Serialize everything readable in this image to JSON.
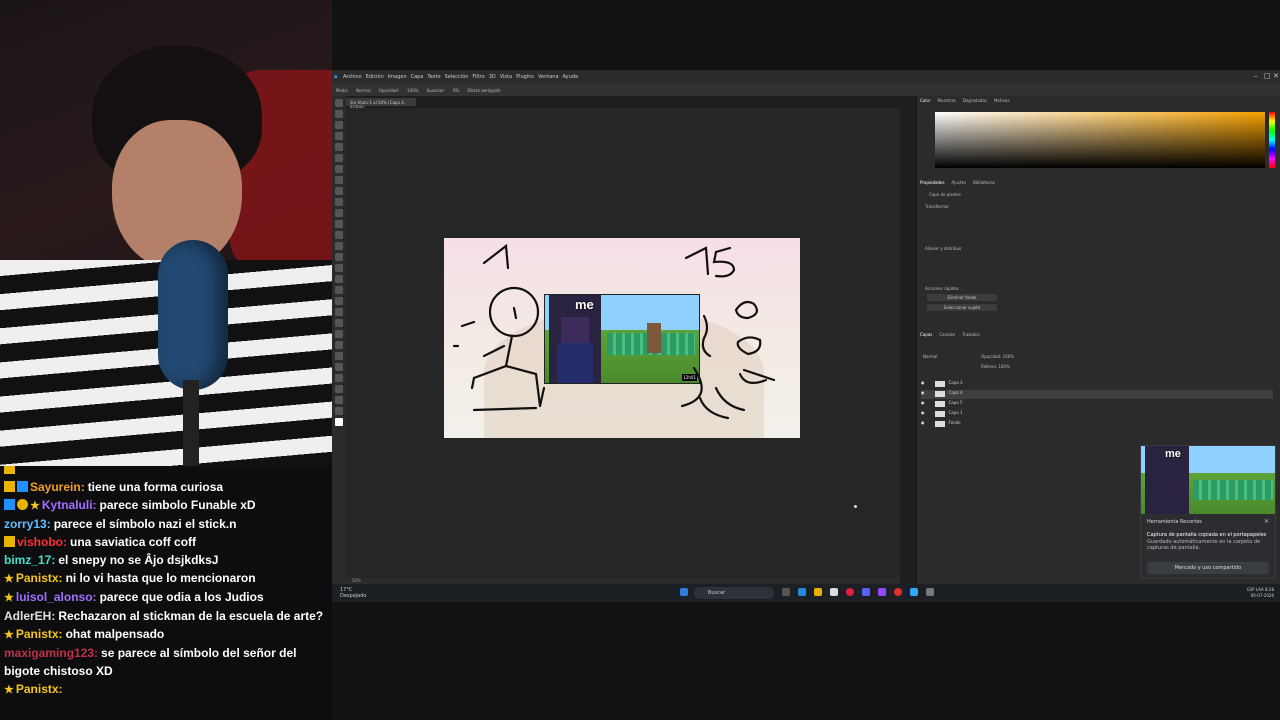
{
  "chat": {
    "messages": [
      {
        "user": "",
        "text": "",
        "user_color": "#e8b400",
        "badges": [
          "crown"
        ]
      },
      {
        "user": "Sayurein:",
        "text": "tiene una forma curiosa",
        "user_color": "#f0a020",
        "badges": [
          "crown",
          "sub"
        ]
      },
      {
        "user": "Kytnaluli:",
        "text": "parece simbolo Funable xD",
        "user_color": "#a070ff",
        "badges": [
          "sub",
          "one",
          "star"
        ]
      },
      {
        "user": "zorry13:",
        "text": "parece el símbolo nazi el stick.n",
        "user_color": "#60c0ff",
        "badges": []
      },
      {
        "user": "vishobo:",
        "text": "una saviatica coff coff",
        "user_color": "#ff3030",
        "badges": [
          "crown"
        ]
      },
      {
        "user": "bimz_17:",
        "text": "el snepy no se Âjo dsjkdksJ",
        "user_color": "#40e0d0",
        "badges": []
      },
      {
        "user": "Panistx:",
        "text": "ni lo vi hasta que lo mencionaron",
        "user_color": "#f5c518",
        "badges": [
          "star"
        ]
      },
      {
        "user": "luisol_alonso:",
        "text": "parece que odia a los Judios",
        "user_color": "#a070ff",
        "badges": [
          "star"
        ]
      },
      {
        "user": "AdlerEH:",
        "text": "Rechazaron al stickman de la escuela de arte?",
        "user_color": "#e0e0e0",
        "badges": []
      },
      {
        "user": "Panistx:",
        "text": "ohat malpensado",
        "user_color": "#f5c518",
        "badges": [
          "star"
        ]
      },
      {
        "user": "maxigaming123:",
        "text": "se parece al símbolo del señor del bigote chistoso XD",
        "user_color": "#c0304a",
        "badges": []
      },
      {
        "user": "Panistx:",
        "text": "",
        "user_color": "#f5c518",
        "badges": [
          "star"
        ]
      }
    ]
  },
  "photoshop": {
    "menu": [
      "Archivo",
      "Edición",
      "Imagen",
      "Capa",
      "Texto",
      "Selección",
      "Filtro",
      "3D",
      "Vista",
      "Plugins",
      "Ventana",
      "Ayuda"
    ],
    "options": [
      "Modo:",
      "Normal",
      "Opacidad:",
      "100%",
      "Suavizar:",
      "0%",
      "Efecto aerógrafo"
    ],
    "doc_tab": "Sin título-1 al 50% (Capa 4, RGB/8)",
    "status": "50%",
    "artwork": {
      "meme_label": "me",
      "stamp": "12h01"
    },
    "panels": {
      "color_tabs": [
        "Color",
        "Muestras",
        "Degradados",
        "Motivos"
      ],
      "props_tabs": [
        "Propiedades",
        "Ajustes",
        "Bibliotecas"
      ],
      "layer_type": "Capa de píxeles",
      "transform": "Transformar",
      "align": "Alinear y distribuir",
      "quick_actions": "Acciones rápidas",
      "remove_bg": "Eliminar fondo",
      "select_subject": "Seleccionar sujeto",
      "layers_tabs": [
        "Capas",
        "Canales",
        "Trazados"
      ],
      "blend_mode": "Normal",
      "opacity": "Opacidad: 100%",
      "fill": "Relleno: 100%",
      "layers": [
        "Capa 3",
        "Capa 4",
        "Capa 5",
        "Capa 1",
        "Fondo"
      ],
      "selected_layer": 1
    }
  },
  "taskbar": {
    "weather": "17°C",
    "weather_desc": "Despejado",
    "search": "Buscar",
    "lang": "ESP",
    "region": "LAA",
    "time": "8:28",
    "date": "06-07-2026"
  },
  "notification": {
    "image_label": "me",
    "app": "Herramienta Recortes",
    "title": "Captura de pantalla copiada en el portapapeles",
    "body": "Guardado automáticamente en la carpeta de capturas de pantalla.",
    "button": "Mercado y uso compartido"
  }
}
